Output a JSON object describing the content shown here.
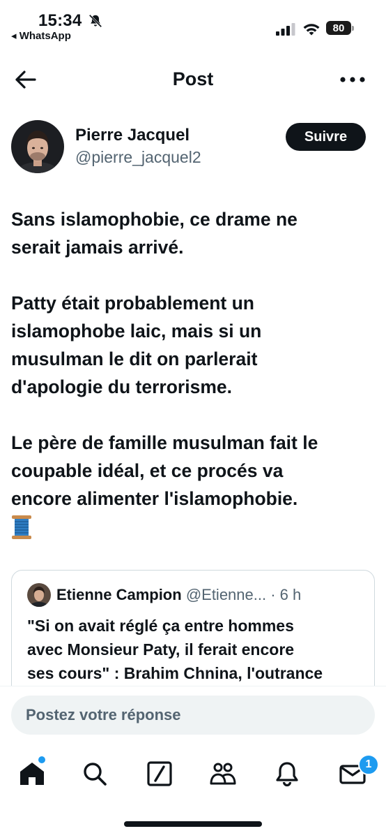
{
  "status_bar": {
    "time": "15:34",
    "back_app": "◂ WhatsApp",
    "battery": "80",
    "icons": [
      "bell-slash-icon",
      "signal-icon",
      "wifi-icon",
      "battery-icon"
    ]
  },
  "header": {
    "title": "Post",
    "icons": [
      "back-arrow-icon",
      "more-icon"
    ]
  },
  "author": {
    "name": "Pierre Jacquel",
    "handle": "@pierre_jacquel2",
    "follow_label": "Suivre"
  },
  "post": {
    "paragraphs": [
      [
        "Sans islamophobie, ce drame ne",
        "serait jamais arrivé."
      ],
      [
        "Patty était probablement un",
        "islamophobe laic, mais si un",
        "musulman le dit on parlerait",
        "d'apologie du terrorisme."
      ],
      [
        "Le père de famille musulman fait le",
        "coupable idéal, et ce procés va",
        "encore alimenter l'islamophobie."
      ]
    ],
    "emoji_icon": "thread-spool-icon"
  },
  "quote": {
    "name": "Etienne Campion",
    "handle_time": "@Etienne... · 6 h",
    "text_lines": [
      "\"Si on avait réglé ça entre hommes",
      "avec Monsieur Paty, il ferait encore",
      "ses cours\" : Brahim Chnina, l'outrance"
    ]
  },
  "reply": {
    "placeholder": "Postez votre réponse"
  },
  "nav": {
    "items": [
      "home-icon",
      "search-icon",
      "grok-icon",
      "communities-icon",
      "notifications-icon",
      "messages-icon"
    ],
    "messages_badge": "1",
    "accent": "#1d9bf0"
  }
}
